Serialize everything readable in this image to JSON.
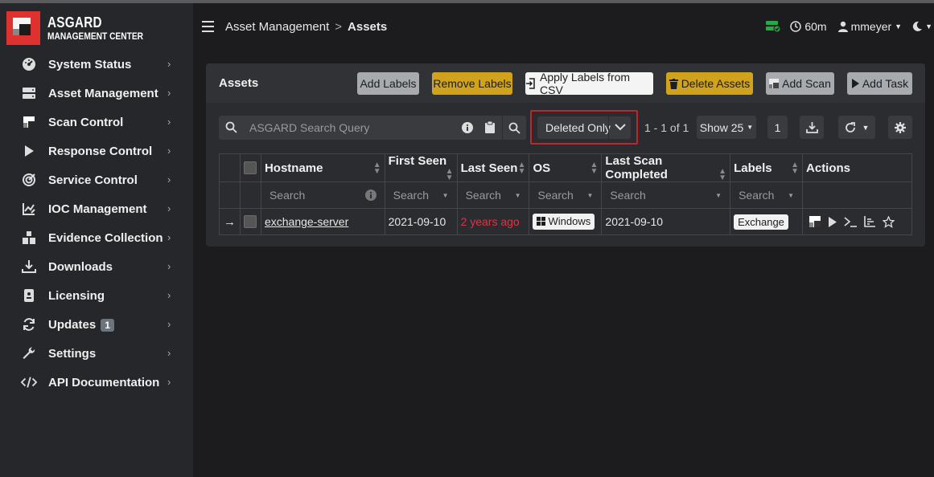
{
  "app": {
    "logo_line1": "ASGARD",
    "logo_line2": "MANAGEMENT CENTER"
  },
  "sidebar": {
    "items": [
      {
        "label": "System Status",
        "icon": "gauge-icon"
      },
      {
        "label": "Asset Management",
        "icon": "server-icon"
      },
      {
        "label": "Scan Control",
        "icon": "scan-icon"
      },
      {
        "label": "Response Control",
        "icon": "play-icon"
      },
      {
        "label": "Service Control",
        "icon": "service-icon"
      },
      {
        "label": "IOC Management",
        "icon": "ioc-icon"
      },
      {
        "label": "Evidence Collection",
        "icon": "evidence-icon"
      },
      {
        "label": "Downloads",
        "icon": "download-icon"
      },
      {
        "label": "Licensing",
        "icon": "license-icon"
      },
      {
        "label": "Updates",
        "icon": "refresh-icon",
        "badge": "1"
      },
      {
        "label": "Settings",
        "icon": "wrench-icon"
      },
      {
        "label": "API Documentation",
        "icon": "code-icon"
      }
    ]
  },
  "header": {
    "breadcrumb_parent": "Asset Management",
    "breadcrumb_sep": ">",
    "breadcrumb_current": "Assets",
    "session_timer": "60m",
    "username": "mmeyer"
  },
  "card": {
    "title": "Assets",
    "buttons": {
      "add_labels": "Add Labels",
      "remove_labels": "Remove Labels",
      "apply_labels_csv": "Apply Labels from CSV",
      "delete_assets": "Delete Assets",
      "add_scan": "Add Scan",
      "add_task": "Add Task"
    },
    "search_placeholder": "ASGARD Search Query",
    "deleted_filter": "Deleted Only",
    "pagination_text": "1 - 1 of 1",
    "show_count": "Show 25",
    "page_number": "1"
  },
  "table": {
    "headers": [
      "Hostname",
      "First Seen",
      "Last Seen",
      "OS",
      "Last Scan Completed",
      "Labels",
      "Actions"
    ],
    "filter_placeholder": "Search",
    "rows": [
      {
        "hostname": "exchange-server",
        "first_seen": "2021-09-10",
        "last_seen": "2 years ago",
        "os": "Windows",
        "last_scan": "2021-09-10",
        "label": "Exchange"
      }
    ]
  },
  "colors": {
    "accent_yellow": "#d1a21c",
    "danger_red": "#e03131",
    "highlight_border": "#c0272d",
    "status_green": "#28a745"
  }
}
